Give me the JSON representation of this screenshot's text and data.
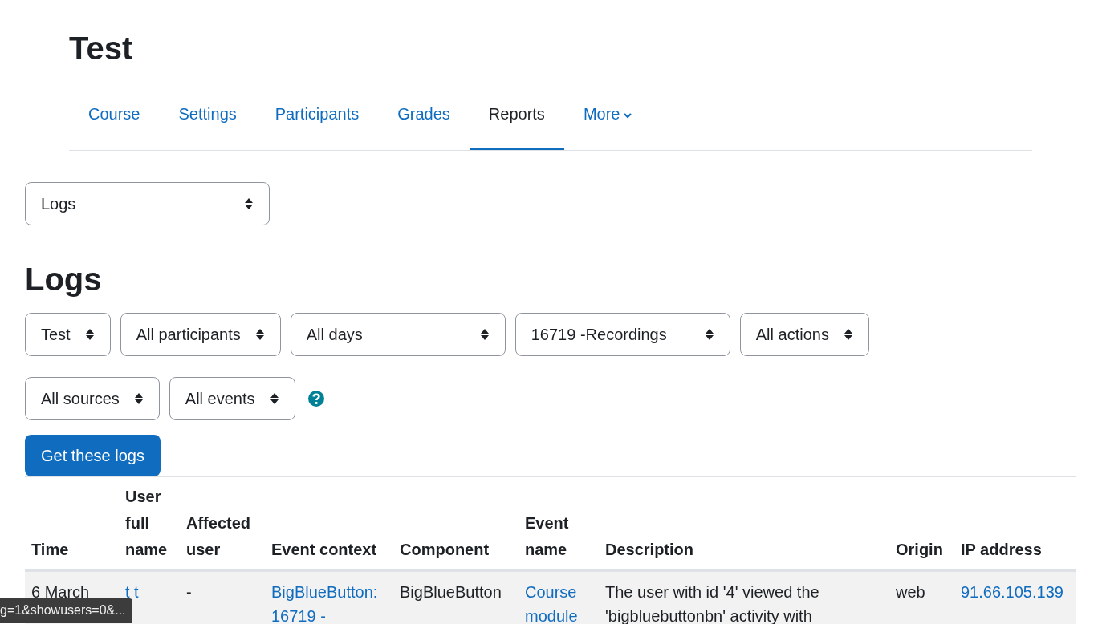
{
  "course_title": "Test",
  "nav_tabs": [
    {
      "label": "Course",
      "selected": false,
      "dropdown": false
    },
    {
      "label": "Settings",
      "selected": false,
      "dropdown": false
    },
    {
      "label": "Participants",
      "selected": false,
      "dropdown": false
    },
    {
      "label": "Grades",
      "selected": false,
      "dropdown": false
    },
    {
      "label": "Reports",
      "selected": true,
      "dropdown": false
    },
    {
      "label": "More",
      "selected": false,
      "dropdown": true
    }
  ],
  "report_select": {
    "value": "Logs"
  },
  "page_heading": "Logs",
  "filters": [
    {
      "value": "Test",
      "wide": false
    },
    {
      "value": "All participants",
      "wide": false
    },
    {
      "value": "All days",
      "wide": true
    },
    {
      "value": "16719 -Recordings",
      "wide": true
    },
    {
      "value": "All actions",
      "wide": false
    },
    {
      "value": "All sources",
      "wide": false
    },
    {
      "value": "All events",
      "wide": false
    }
  ],
  "submit_button": "Get these logs",
  "table": {
    "columns": [
      "Time",
      "User full name",
      "Affected user",
      "Event context",
      "Component",
      "Event name",
      "Description",
      "Origin",
      "IP address"
    ],
    "rows": [
      [
        {
          "text": "6 March",
          "link": false
        },
        {
          "text": "t t",
          "link": true
        },
        {
          "text": "-",
          "link": false
        },
        {
          "text": "BigBlueButton: 16719 -",
          "link": true
        },
        {
          "text": "BigBlueButton",
          "link": false
        },
        {
          "text": "Course module",
          "link": true
        },
        {
          "text": "The user with id '4' viewed the 'bigbluebuttonbn' activity with",
          "link": false
        },
        {
          "text": "web",
          "link": false
        },
        {
          "text": "91.66.105.139",
          "link": true
        }
      ]
    ]
  },
  "status_bar": "g=1&showusers=0&..."
}
